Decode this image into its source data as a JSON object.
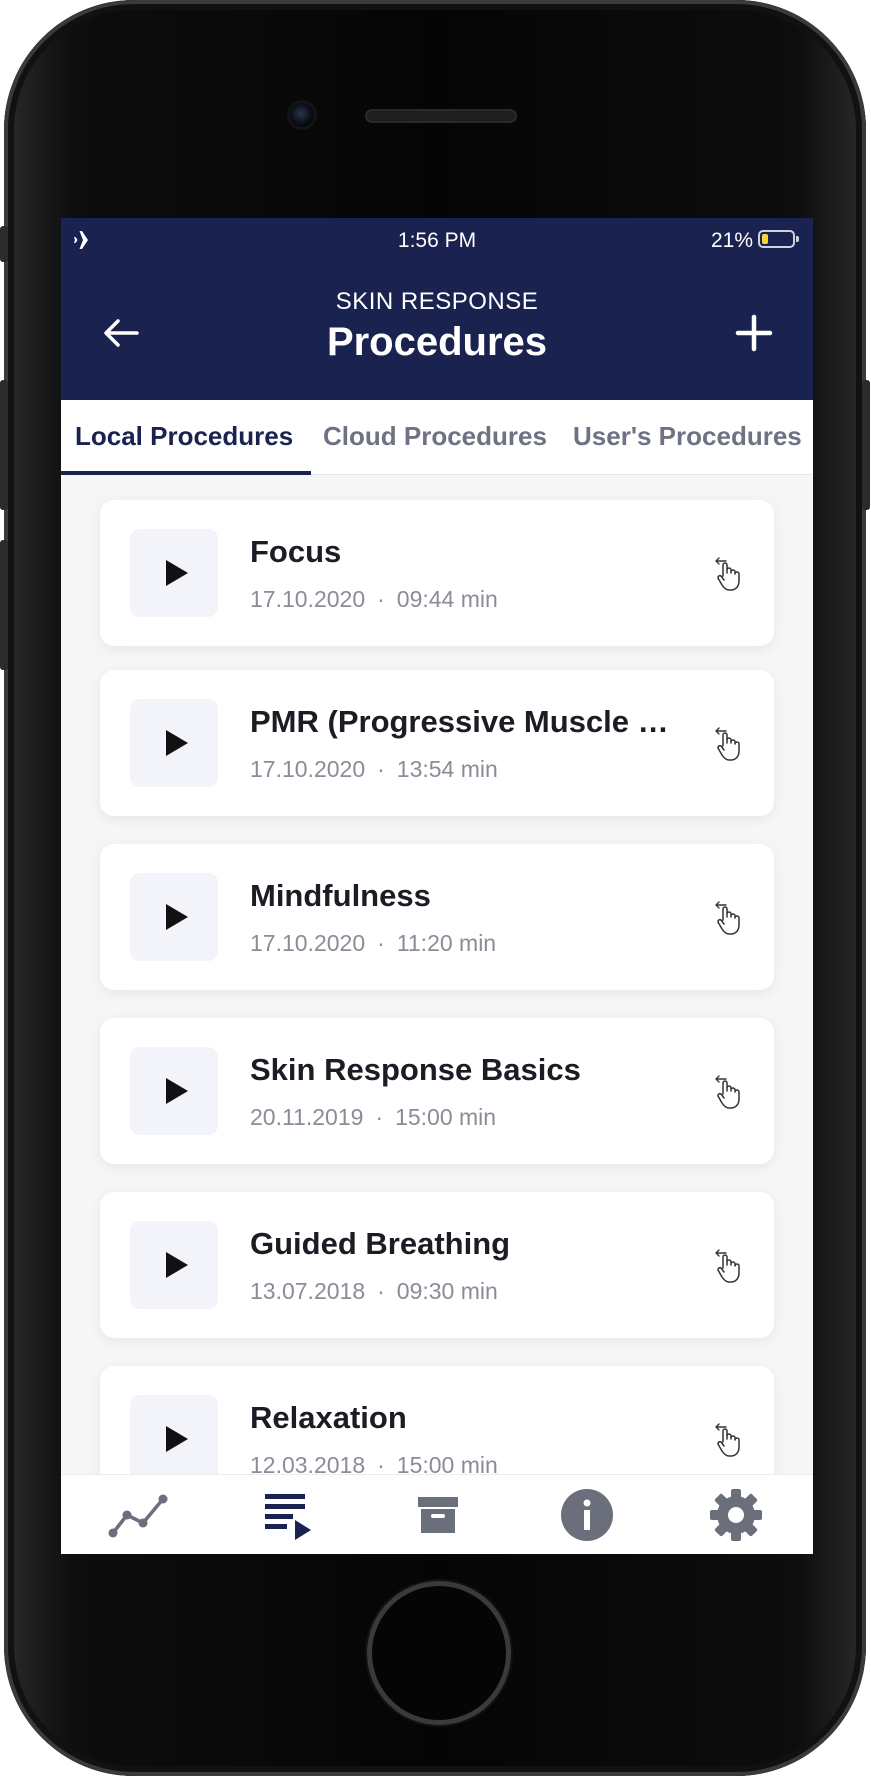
{
  "status_bar": {
    "time": "1:56 PM",
    "battery": "21%",
    "icons": [
      "airplane-icon",
      "battery-icon"
    ]
  },
  "header": {
    "subtitle": "SKIN RESPONSE",
    "title": "Procedures",
    "back_icon": "arrow-left-icon",
    "add_icon": "plus-icon",
    "background_color": "#1a2250"
  },
  "tabs": [
    {
      "label": "Local Procedures",
      "active": true
    },
    {
      "label": "Cloud Procedures",
      "active": false
    },
    {
      "label": "User's Procedures",
      "active": false
    }
  ],
  "procedures": [
    {
      "title": "Focus",
      "date": "17.10.2020",
      "separator": "·",
      "duration": "09:44 min"
    },
    {
      "title": "PMR (Progressive Muscle Relaxation)",
      "date": "17.10.2020",
      "separator": "·",
      "duration": "13:54 min"
    },
    {
      "title": "Mindfulness",
      "date": "17.10.2020",
      "separator": "·",
      "duration": "11:20 min"
    },
    {
      "title": "Skin Response Basics",
      "date": "20.11.2019",
      "separator": "·",
      "duration": "15:00 min"
    },
    {
      "title": "Guided Breathing",
      "date": "13.07.2018",
      "separator": "·",
      "duration": "09:30 min"
    },
    {
      "title": "Relaxation",
      "date": "12.03.2018",
      "separator": "·",
      "duration": "15:00 min"
    }
  ],
  "bottom_nav": [
    {
      "icon": "chart-line-icon",
      "active": false
    },
    {
      "icon": "playlist-icon",
      "active": true
    },
    {
      "icon": "archive-icon",
      "active": false
    },
    {
      "icon": "info-icon",
      "active": false
    },
    {
      "icon": "gear-icon",
      "active": false
    }
  ]
}
